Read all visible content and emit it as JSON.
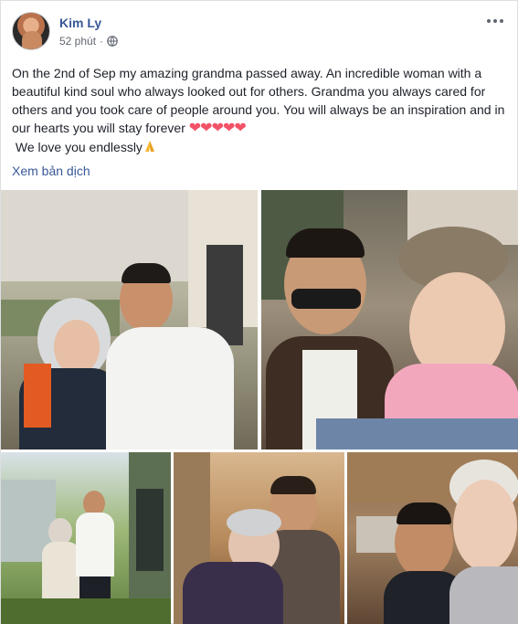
{
  "post": {
    "author": "Kim Ly",
    "time": "52 phút",
    "separator": "·",
    "privacy_icon": "globe-icon",
    "menu_icon": "more-options-icon",
    "text_line1": "On the 2nd of Sep my amazing grandma passed away. An incredible woman with a beautiful kind soul who always looked out for others. Grandma you always cared for others and you took care of people around you. You will always be an inspiration and in our hearts you will stay forever",
    "hearts": "❤❤❤❤❤",
    "text_line2": "We love you endlessly",
    "pray_icon": "folded-hands-icon",
    "translate_label": "Xem bản dịch"
  },
  "colors": {
    "link": "#385898",
    "text": "#1d2129",
    "meta": "#616770",
    "heart": "#f25268"
  },
  "photos": [
    {
      "name": "photo-1",
      "subject": "grandma and man in white shirt on balcony"
    },
    {
      "name": "photo-2",
      "subject": "man in sunglasses with grandma in hat"
    },
    {
      "name": "photo-3",
      "subject": "grandma and man in garden"
    },
    {
      "name": "photo-4",
      "subject": "grandma hugging man indoors"
    },
    {
      "name": "photo-5",
      "subject": "man and grandma selfie in kitchen"
    }
  ]
}
